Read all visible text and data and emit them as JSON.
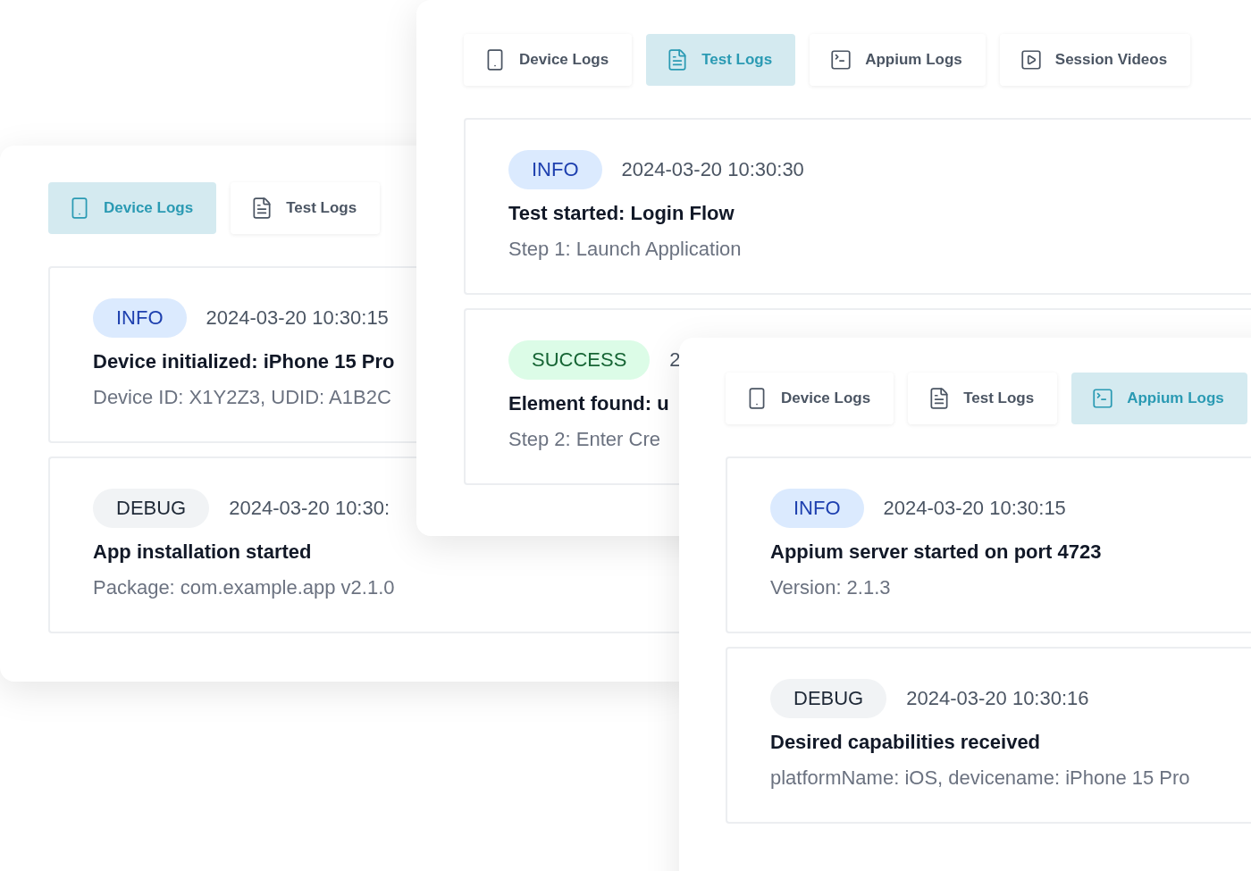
{
  "panels": [
    {
      "tabs": [
        {
          "label": "Device Logs",
          "kind": "device",
          "selected": true
        },
        {
          "label": "Test Logs",
          "kind": "test",
          "selected": false
        }
      ],
      "entries": [
        {
          "kind": "info",
          "badge": "INFO",
          "time": "2024-03-20 10:30:15",
          "title": "Device initialized: iPhone 15 Pro",
          "detail": "Device ID: X1Y2Z3, UDID: A1B2C"
        },
        {
          "kind": "debug",
          "badge": "DEBUG",
          "time": "2024-03-20 10:30:",
          "title": "App installation started",
          "detail": "Package: com.example.app v2.1.0"
        }
      ]
    },
    {
      "tabs": [
        {
          "label": "Device Logs",
          "kind": "device",
          "selected": false
        },
        {
          "label": "Test Logs",
          "kind": "test",
          "selected": true
        },
        {
          "label": "Appium Logs",
          "kind": "appium",
          "selected": false
        },
        {
          "label": "Session Videos",
          "kind": "video",
          "selected": false
        }
      ],
      "entries": [
        {
          "kind": "info",
          "badge": "INFO",
          "time": "2024-03-20 10:30:30",
          "title": "Test started: Login Flow",
          "detail": "Step 1: Launch Application"
        },
        {
          "kind": "success",
          "badge": "SUCCESS",
          "time": "2",
          "title": "Element found: u",
          "detail": "Step 2: Enter Cre"
        }
      ]
    },
    {
      "tabs": [
        {
          "label": "Device Logs",
          "kind": "device",
          "selected": false
        },
        {
          "label": "Test Logs",
          "kind": "test",
          "selected": false
        },
        {
          "label": "Appium Logs",
          "kind": "appium",
          "selected": true
        }
      ],
      "entries": [
        {
          "kind": "info",
          "badge": "INFO",
          "time": "2024-03-20 10:30:15",
          "title": "Appium server started on port 4723",
          "detail": "Version: 2.1.3"
        },
        {
          "kind": "debug",
          "badge": "DEBUG",
          "time": "2024-03-20 10:30:16",
          "title": "Desired capabilities received",
          "detail": "platformName: iOS, devicename: iPhone 15 Pro"
        }
      ]
    }
  ]
}
